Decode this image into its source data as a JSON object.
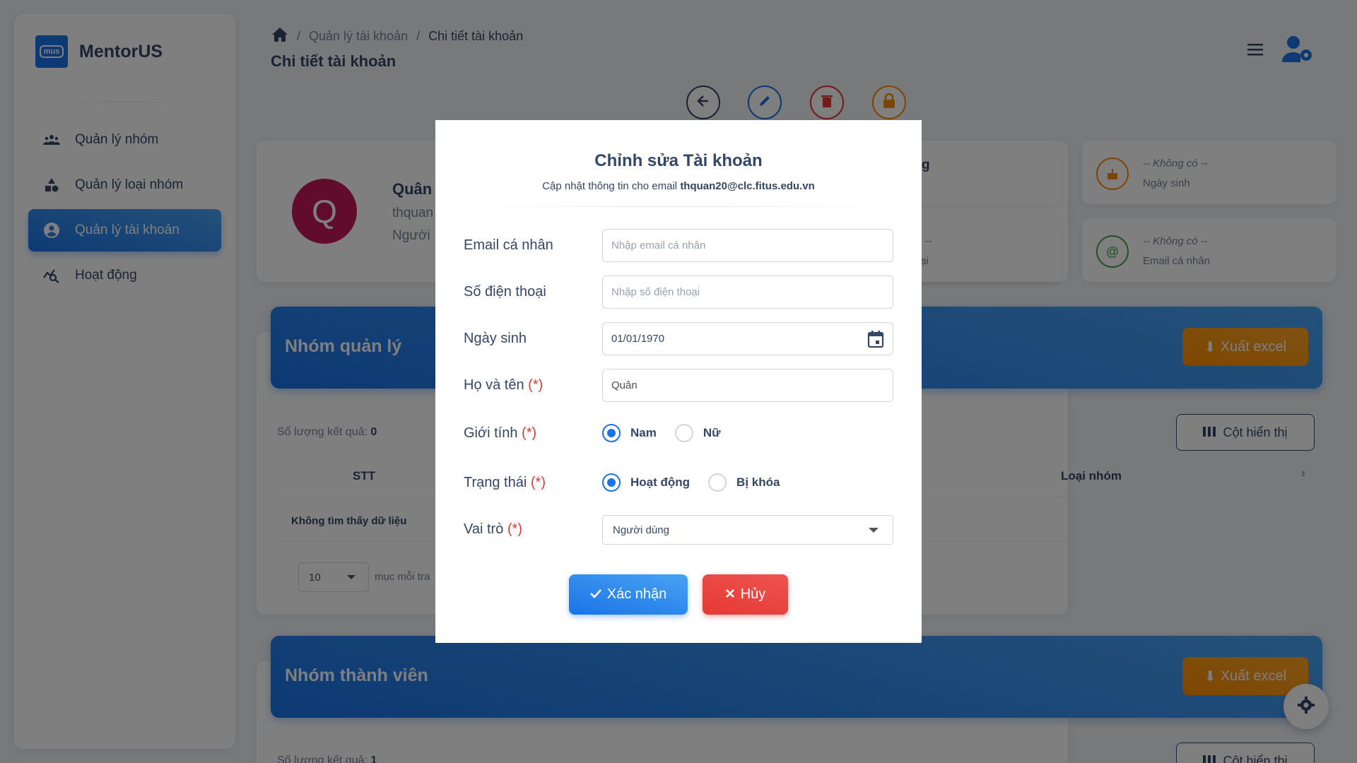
{
  "app": {
    "name": "MentorUS",
    "logo_text": "mus"
  },
  "sidebar": {
    "items": [
      {
        "label": "Quản lý nhóm",
        "icon": "groups-icon"
      },
      {
        "label": "Quản lý loại nhóm",
        "icon": "category-icon"
      },
      {
        "label": "Quản lý tài khoản",
        "icon": "account-circle-icon",
        "active": true
      },
      {
        "label": "Hoạt động",
        "icon": "query-stats-icon"
      }
    ]
  },
  "header": {
    "breadcrumb": [
      "Quản lý tài khoản",
      "Chi tiết tài khoản"
    ],
    "title": "Chi tiết tài khoản"
  },
  "profile": {
    "initial": "Q",
    "name": "Quân",
    "email": "thquan",
    "role": "Người"
  },
  "info_cards": [
    {
      "value": "-- Không có --",
      "label": "Ngày sinh",
      "icon": "cake-icon",
      "color": "#fb8c00"
    },
    {
      "value": "-- Không có --",
      "label": "Email cá nhân",
      "icon": "at-icon",
      "color": "#43a047"
    }
  ],
  "partial_cards": {
    "top": "g",
    "bottom_value": "ó --",
    "bottom_label": "oại"
  },
  "tables": [
    {
      "title": "Nhóm quản lý",
      "export_label": "Xuất excel",
      "count_label": "Số lượng kết quả:",
      "count": "0",
      "columns_label": "Cột hiển thị",
      "headers": [
        "STT",
        "Loại nhóm"
      ],
      "empty": "Không tìm thấy dữ liệu",
      "per_page": "10",
      "per_page_label": "mục mỗi tra"
    },
    {
      "title": "Nhóm thành viên",
      "export_label": "Xuất excel",
      "count_label": "Số lượng kết quả:",
      "count": "1",
      "columns_label": "Cột hiển thị"
    }
  ],
  "modal": {
    "title": "Chỉnh sửa Tài khoản",
    "subtitle_prefix": "Cập nhật thông tin cho email",
    "subtitle_email": "thquan20@clc.fitus.edu.vn",
    "fields": {
      "personal_email": {
        "label": "Email cá nhân",
        "placeholder": "Nhập email cá nhân",
        "value": ""
      },
      "phone": {
        "label": "Số điện thoại",
        "placeholder": "Nhập số điện thoại",
        "value": ""
      },
      "birthday": {
        "label": "Ngày sinh",
        "value": "01/01/1970"
      },
      "fullname": {
        "label": "Họ và tên",
        "required": "(*)",
        "value": "Quân"
      },
      "gender": {
        "label": "Giới tính",
        "required": "(*)",
        "options": [
          "Nam",
          "Nữ"
        ],
        "selected": "Nam"
      },
      "status": {
        "label": "Trạng thái",
        "required": "(*)",
        "options": [
          "Hoạt động",
          "Bị khóa"
        ],
        "selected": "Hoạt động"
      },
      "role": {
        "label": "Vai trò",
        "required": "(*)",
        "value": "Người dùng"
      }
    },
    "confirm_label": "Xác nhận",
    "cancel_label": "Hủy"
  },
  "colors": {
    "primary": "#1a73e8",
    "danger": "#e53935",
    "warning": "#fb8c00",
    "success": "#43a047",
    "avatar": "#c2185b",
    "text": "#344767"
  }
}
